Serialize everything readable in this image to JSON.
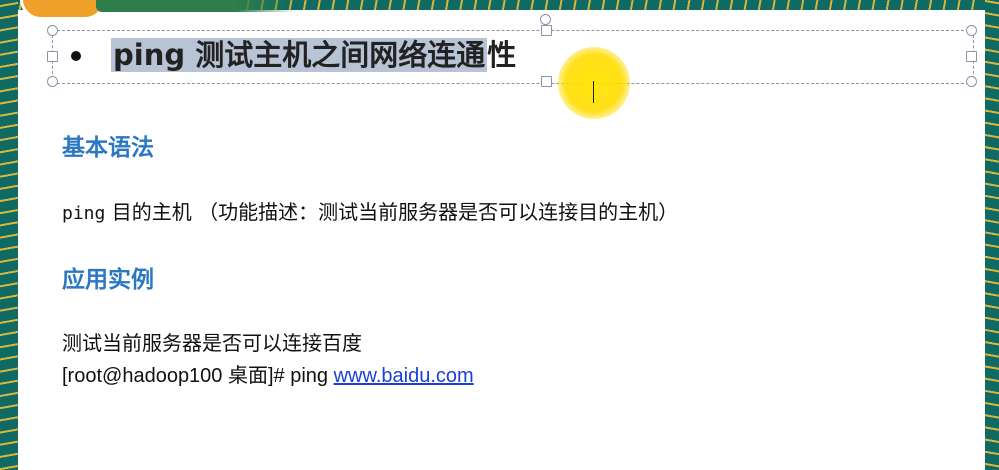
{
  "slide": {
    "title_bullet": "●",
    "title_selected": "ping 测试主机之间网络连通",
    "title_rest": "性",
    "section_syntax": "基本语法",
    "syntax_cmd": "ping",
    "syntax_desc": " 目的主机 （功能描述：测试当前服务器是否可以连接目的主机）",
    "section_example": "应用实例",
    "example_desc": "测试当前服务器是否可以连接百度",
    "example_prompt": "[root@hadoop100 桌面]# ping ",
    "example_link": "www.baidu.com"
  },
  "colors": {
    "heading": "#2a78c2",
    "link": "#1a3fd6",
    "selection": "#b9c3d6",
    "cursor_highlight": "#ffe600"
  },
  "icons": [
    "bullet-icon",
    "resize-handle-icon",
    "text-cursor-icon"
  ]
}
